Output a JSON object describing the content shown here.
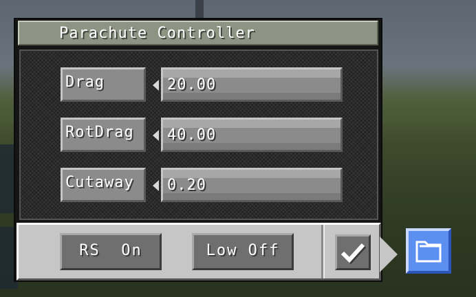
{
  "window": {
    "title": "Parachute Controller"
  },
  "fields": [
    {
      "label": "Drag",
      "value": "20.00"
    },
    {
      "label": "RotDrag",
      "value": "40.00"
    },
    {
      "label": "Cutaway",
      "value": "0.20"
    }
  ],
  "toolbar": {
    "rs_label": "RS  On",
    "low_label": "Low Off",
    "confirm_icon": "checkmark-icon",
    "folder_icon": "folder-icon"
  },
  "colors": {
    "panel_bg": "#151515",
    "title_bar": "#8e9484",
    "field_bg": "#8b8b8b",
    "button_bg": "#6f6f6f",
    "toolbar_bg": "#c6c6c6",
    "folder_accent": "#5b8ff0"
  }
}
